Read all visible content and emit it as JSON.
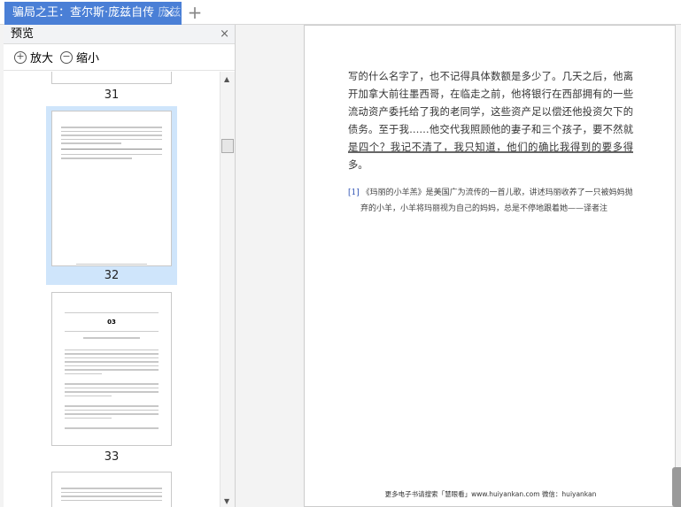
{
  "tab": {
    "title": "骗局之王：查尔斯·庞兹自传",
    "title_faded": "庞兹",
    "close": "×",
    "new_tab": "+"
  },
  "panel": {
    "title": "预览",
    "close": "×",
    "zoom_in": "放大",
    "zoom_out": "缩小"
  },
  "thumbnails": [
    {
      "page": "31"
    },
    {
      "page": "32",
      "selected": true
    },
    {
      "page": "33",
      "chapter": "03"
    }
  ],
  "page": {
    "body": "写的什么名字了，也不记得具体数额是多少了。几天之后，他离开加拿大前往墨西哥，在临走之前，他将银行在西部拥有的一些流动资产委托给了我的老同学，这些资产足以偿还他投资欠下的债务。至于我……他交代我照顾他的妻子和三个孩子，要不然就是四个？我记不清了，我只知道，他们的确比我得到的要多得多。",
    "note_ref": "[1]",
    "note": "《玛丽的小羊羔》是美国广为流传的一首儿歌，讲述玛丽收养了一只被妈妈抛弃的小羊，小羊将玛丽视为自己的妈妈，总是不停地跟着她——译者注",
    "footer": "更多电子书请搜索「慧眼看」www.huiyankan.com 微信：huiyankan"
  }
}
